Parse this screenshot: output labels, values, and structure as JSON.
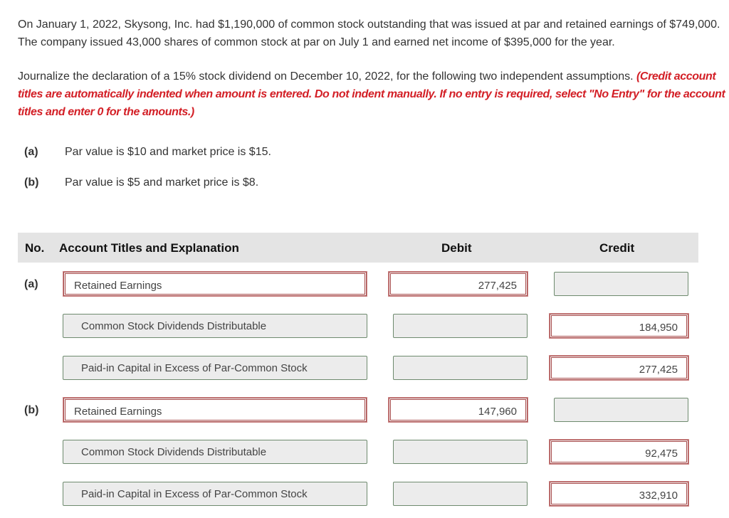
{
  "problem": {
    "intro": "On January 1, 2022, Skysong, Inc. had $1,190,000 of common stock outstanding that was issued at par and retained earnings of $749,000. The company issued 43,000 shares of common stock at par on July 1 and earned net income of $395,000 for the year.",
    "instruction": "Journalize the declaration of a 15% stock dividend on December 10, 2022, for the following two independent assumptions.",
    "instruction_note": "(Credit account titles are automatically indented when amount is entered. Do not indent manually. If no entry is required, select \"No Entry\" for the account titles and enter 0 for the amounts.)",
    "assumptions": [
      {
        "label": "(a)",
        "text": "Par value is $10 and market price is $15."
      },
      {
        "label": "(b)",
        "text": "Par value is $5 and market price is $8."
      }
    ]
  },
  "table": {
    "headers": {
      "no": "No.",
      "account": "Account Titles and Explanation",
      "debit": "Debit",
      "credit": "Credit"
    },
    "entries": [
      {
        "no": "(a)",
        "rows": [
          {
            "account": "Retained Earnings",
            "debit": "277,425",
            "credit": ""
          },
          {
            "account": "Common Stock Dividends Distributable",
            "debit": "",
            "credit": "184,950"
          },
          {
            "account": "Paid-in Capital in Excess of Par-Common Stock",
            "debit": "",
            "credit": "277,425"
          }
        ]
      },
      {
        "no": "(b)",
        "rows": [
          {
            "account": "Retained Earnings",
            "debit": "147,960",
            "credit": ""
          },
          {
            "account": "Common Stock Dividends Distributable",
            "debit": "",
            "credit": "92,475"
          },
          {
            "account": "Paid-in Capital in Excess of Par-Common Stock",
            "debit": "",
            "credit": "332,910"
          }
        ]
      }
    ]
  },
  "colors": {
    "instruction_red": "#d31f26",
    "filled_border": "#a64a4a",
    "empty_border": "#6e8a6e",
    "header_bg": "#e4e4e4"
  }
}
